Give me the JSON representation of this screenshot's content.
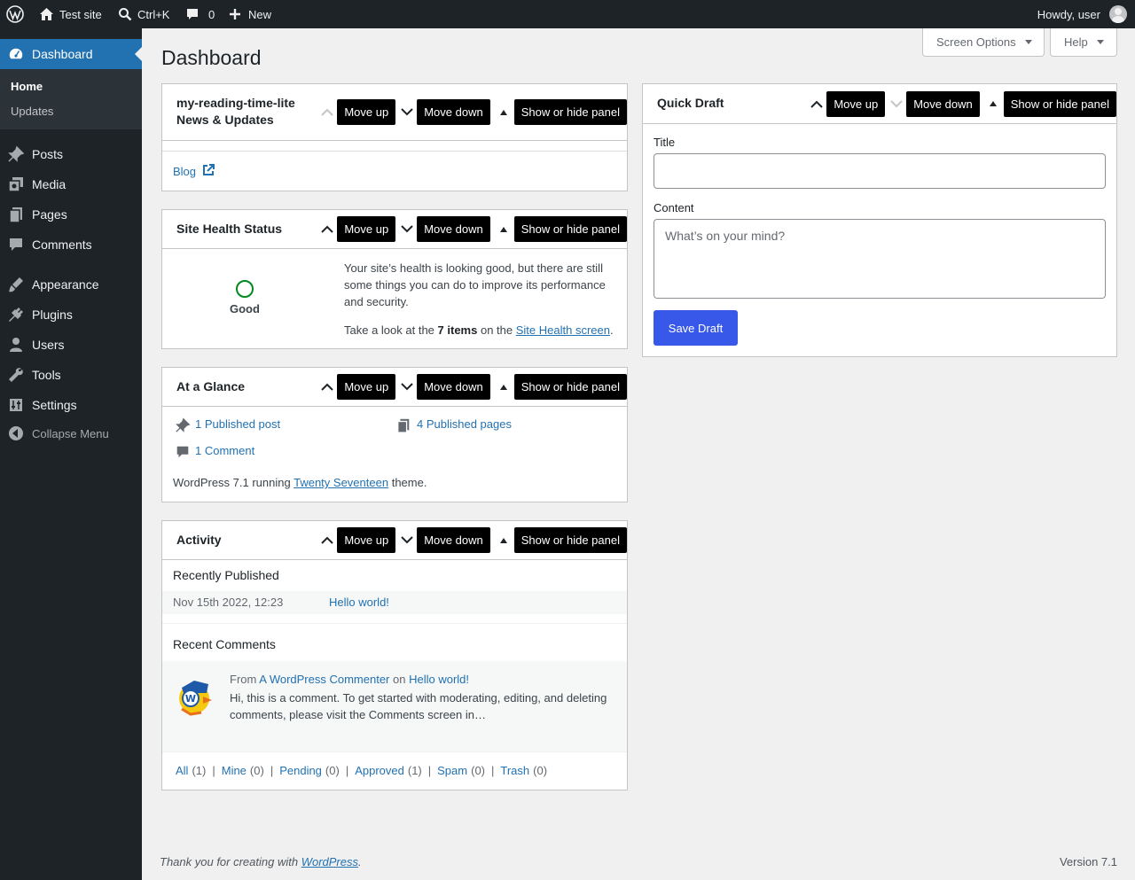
{
  "adminbar": {
    "site_name": "Test site",
    "search_shortcut": "Ctrl+K",
    "comments_count": "0",
    "new_label": "New",
    "greeting": "Howdy, user"
  },
  "sidebar": {
    "dashboard": "Dashboard",
    "home": "Home",
    "updates": "Updates",
    "items": [
      {
        "label": "Posts",
        "icon": "pushpin-icon"
      },
      {
        "label": "Media",
        "icon": "media-icon"
      },
      {
        "label": "Pages",
        "icon": "pages-icon"
      },
      {
        "label": "Comments",
        "icon": "comment-icon"
      },
      {
        "label": "Appearance",
        "icon": "brush-icon"
      },
      {
        "label": "Plugins",
        "icon": "plug-icon"
      },
      {
        "label": "Users",
        "icon": "user-icon"
      },
      {
        "label": "Tools",
        "icon": "wrench-icon"
      },
      {
        "label": "Settings",
        "icon": "settings-icon"
      }
    ],
    "collapse": "Collapse Menu"
  },
  "header": {
    "title": "Dashboard",
    "screen_options": "Screen Options",
    "help": "Help"
  },
  "controls": {
    "move_up": "Move up",
    "move_down": "Move down",
    "toggle": "Show or hide panel"
  },
  "news": {
    "title": "my-reading-time-lite News & Updates",
    "blog_link": "Blog"
  },
  "health": {
    "title": "Site Health Status",
    "status": "Good",
    "description": "Your site’s health is looking good, but there are still some things you can do to improve its performance and security.",
    "take_look": "Take a look at the",
    "items_count": "7 items",
    "on_the": "on the",
    "screen_link": "Site Health screen",
    "period": "."
  },
  "glance": {
    "title": "At a Glance",
    "posts": "1 Published post",
    "pages": "4 Published pages",
    "comments": "1 Comment",
    "running_prefix": "WordPress 7.1 running",
    "theme": "Twenty Seventeen",
    "running_suffix": "theme."
  },
  "activity": {
    "title": "Activity",
    "recently_published": "Recently Published",
    "post_date": "Nov 15th 2022, 12:23",
    "post_title": "Hello world!",
    "recent_comments": "Recent Comments",
    "from": "From",
    "commenter": "A WordPress Commenter",
    "on": "on",
    "comment_post": "Hello world!",
    "excerpt": "Hi, this is a comment. To get started with moderating, editing, and deleting comments, please visit the Comments screen in…",
    "filters": [
      {
        "label": "All",
        "count": "(1)"
      },
      {
        "label": "Mine",
        "count": "(0)"
      },
      {
        "label": "Pending",
        "count": "(0)"
      },
      {
        "label": "Approved",
        "count": "(1)"
      },
      {
        "label": "Spam",
        "count": "(0)"
      },
      {
        "label": "Trash",
        "count": "(0)"
      }
    ]
  },
  "quickdraft": {
    "title": "Quick Draft",
    "title_label": "Title",
    "title_value": "",
    "content_label": "Content",
    "content_placeholder": "What’s on your mind?",
    "save": "Save Draft"
  },
  "footer": {
    "thanks_prefix": "Thank you for creating with",
    "wordpress": "WordPress",
    "version": "Version 7.1"
  },
  "colors": {
    "adminbar": "#1d2327",
    "accent": "#2271b1",
    "primary_button": "#3858e9",
    "health_good": "#008a20"
  }
}
